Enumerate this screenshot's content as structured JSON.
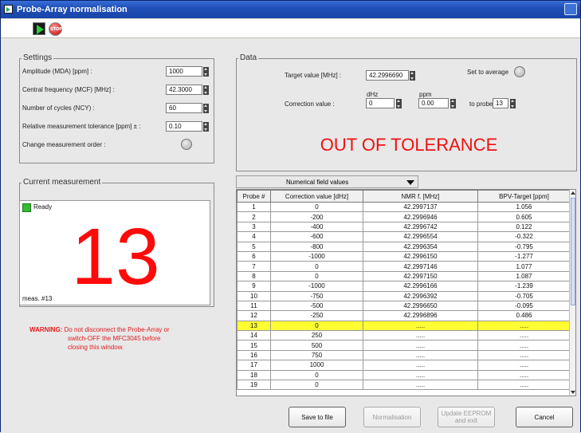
{
  "window": {
    "title": "Probe-Array normalisation"
  },
  "toolbar": {
    "run": "run-icon",
    "stop": "stop-icon",
    "stop_text": "STOP"
  },
  "settings": {
    "group_label": "Settings",
    "fields": [
      {
        "label": "Amplitude (MDA) [ppm] :",
        "value": "1000"
      },
      {
        "label": "Central frequency (MCF) [MHz] :",
        "value": "42.3000"
      },
      {
        "label": "Number of cycles (NCY) :",
        "value": "60"
      },
      {
        "label": "Relative measurement tolerance [ppm] ± :",
        "value": "0.10"
      }
    ],
    "order_label": "Change measurement order :"
  },
  "data_group": {
    "group_label": "Data",
    "target_label": "Target value [MHz] :",
    "target_value": "42.2996690",
    "set_avg_label": "Set to average",
    "correction_label": "Correction value :",
    "dhz_unit": "dHz",
    "dhz_value": "0",
    "ppm_unit": "ppm",
    "ppm_value": "0.00",
    "to_probe_label": "to probe",
    "to_probe_value": "13"
  },
  "status": {
    "tolerance_text": "OUT OF TOLERANCE"
  },
  "current": {
    "group_label": "Current measurement",
    "ready_label": "Ready",
    "big_number": "13",
    "meas_label": "meas. #13"
  },
  "warning": {
    "prefix": "WARNING:",
    "line1": "Do not disconnect the Probe-Array or",
    "line2": "switch-OFF the MFC3045 before",
    "line3": "closing this window."
  },
  "selector": {
    "value": "Numerical field values"
  },
  "table": {
    "headers": [
      "Probe #",
      "Correction value [dHz]",
      "NMR f. [MHz]",
      "BPV-Target [ppm]"
    ],
    "rows": [
      [
        "1",
        "0",
        "42.2997137",
        "1.056"
      ],
      [
        "2",
        "-200",
        "42.2996946",
        "0.605"
      ],
      [
        "3",
        "-400",
        "42.2996742",
        "0.122"
      ],
      [
        "4",
        "-600",
        "42.2996554",
        "-0.322"
      ],
      [
        "5",
        "-800",
        "42.2996354",
        "-0.795"
      ],
      [
        "6",
        "-1000",
        "42.2996150",
        "-1.277"
      ],
      [
        "7",
        "0",
        "42.2997146",
        "1.077"
      ],
      [
        "8",
        "0",
        "42.2997150",
        "1.087"
      ],
      [
        "9",
        "-1000",
        "42.2996166",
        "-1.239"
      ],
      [
        "10",
        "-750",
        "42.2996392",
        "-0.705"
      ],
      [
        "11",
        "-500",
        "42.2996650",
        "-0.095"
      ],
      [
        "12",
        "-250",
        "42.2996896",
        "0.486"
      ],
      [
        "13",
        "0",
        ".....",
        "....."
      ],
      [
        "14",
        "250",
        ".....",
        "....."
      ],
      [
        "15",
        "500",
        ".....",
        "....."
      ],
      [
        "16",
        "750",
        ".....",
        "....."
      ],
      [
        "17",
        "1000",
        ".....",
        "....."
      ],
      [
        "18",
        "0",
        ".....",
        "....."
      ],
      [
        "19",
        "0",
        ".....",
        "....."
      ]
    ],
    "highlight_row": 13
  },
  "buttons": {
    "save": "Save to file",
    "normalisation": "Normalisation",
    "update_line1": "Update EEPROM",
    "update_line2": "and exit",
    "cancel": "Cancel"
  }
}
